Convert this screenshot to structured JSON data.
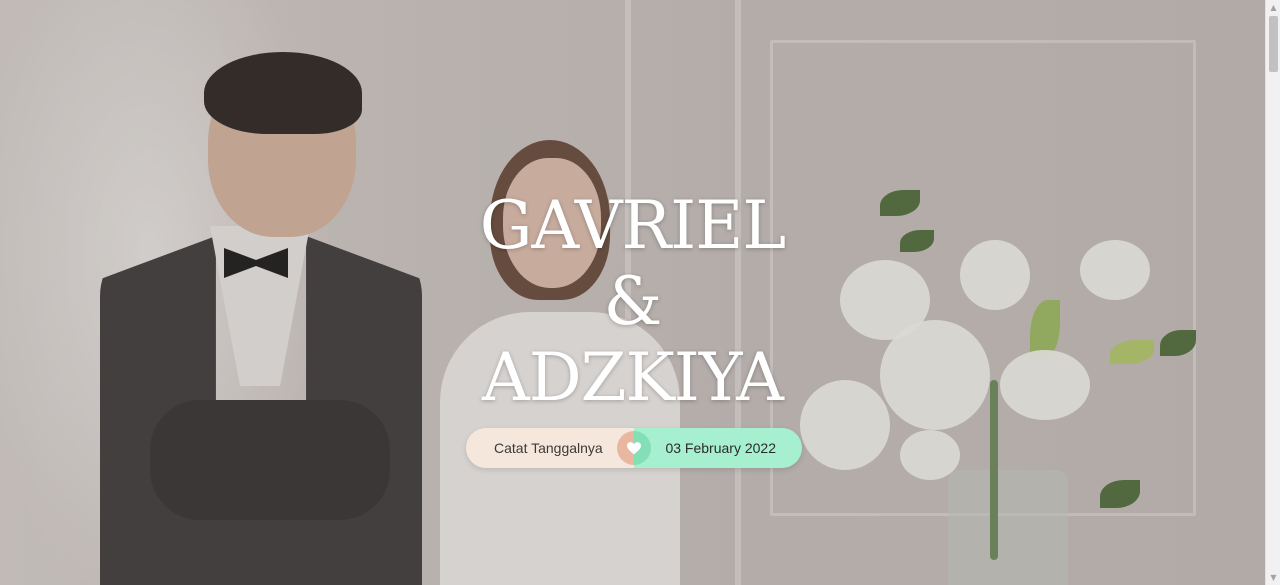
{
  "hero": {
    "name_top": "GAVRIEL",
    "ampersand": "&",
    "name_bottom": "ADZKIYA"
  },
  "save_date": {
    "label": "Catat Tanggalnya",
    "date": "03 February 2022",
    "icon": "heart-icon"
  },
  "colors": {
    "pill_left": "#f6e7dc",
    "pill_right": "#a6efcf",
    "text": "#ffffff"
  }
}
